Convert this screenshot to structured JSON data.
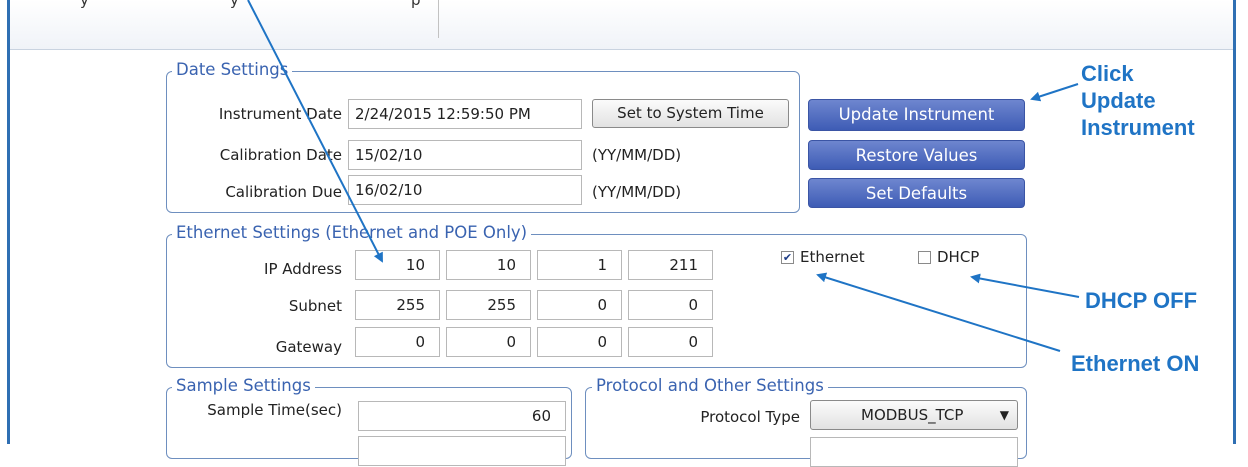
{
  "date_settings": {
    "legend": "Date Settings",
    "instrument_date_label": "Instrument Date",
    "instrument_date_value": "2/24/2015 12:59:50 PM",
    "set_system_time_label": "Set to System Time",
    "calibration_date_label": "Calibration Date",
    "calibration_date_value": "15/02/10",
    "calibration_date_format": "(YY/MM/DD)",
    "calibration_due_label": "Calibration Due",
    "calibration_due_value": "16/02/10",
    "calibration_due_format": "(YY/MM/DD)"
  },
  "actions": {
    "update_instrument": "Update Instrument",
    "restore_values": "Restore Values",
    "set_defaults": "Set Defaults"
  },
  "ethernet_settings": {
    "legend": "Ethernet Settings (Ethernet and POE Only)",
    "ip_label": "IP Address",
    "ip": [
      "10",
      "10",
      "1",
      "211"
    ],
    "subnet_label": "Subnet",
    "subnet": [
      "255",
      "255",
      "0",
      "0"
    ],
    "gateway_label": "Gateway",
    "gateway": [
      "0",
      "0",
      "0",
      "0"
    ],
    "ethernet_label": "Ethernet",
    "ethernet_checked": true,
    "dhcp_label": "DHCP",
    "dhcp_checked": false
  },
  "sample_settings": {
    "legend": "Sample Settings",
    "sample_time_label": "Sample Time(sec)",
    "sample_time_value": "60"
  },
  "protocol_settings": {
    "legend": "Protocol and Other Settings",
    "protocol_type_label": "Protocol Type",
    "protocol_type_value": "MODBUS_TCP"
  },
  "annotations": {
    "click_update": [
      "Click",
      "Update",
      "Instrument"
    ],
    "dhcp_off": "DHCP OFF",
    "ethernet_on": "Ethernet ON",
    "color": "#1f74c5"
  }
}
